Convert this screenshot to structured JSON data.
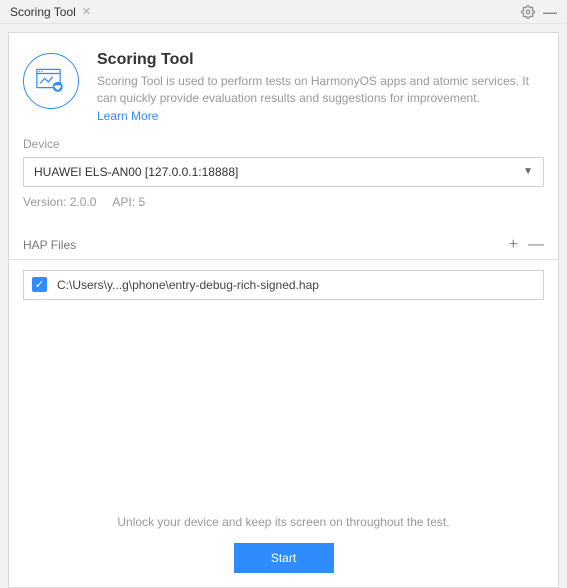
{
  "titlebar": {
    "tab_label": "Scoring Tool"
  },
  "header": {
    "title": "Scoring Tool",
    "desc": "Scoring Tool is used to perform tests on HarmonyOS apps and atomic services. It can quickly provide evaluation results and suggestions for improvement.",
    "learn_more": "Learn More"
  },
  "device": {
    "label": "Device",
    "selected": "HUAWEI ELS-AN00 [127.0.0.1:18888]",
    "version_label": "Version:",
    "version_value": "2.0.0",
    "api_label": "API:",
    "api_value": "5"
  },
  "hap": {
    "title": "HAP Files",
    "items": [
      {
        "checked": true,
        "path": "C:\\Users\\y...g\\phone\\entry-debug-rich-signed.hap"
      }
    ]
  },
  "footer": {
    "hint": "Unlock your device and keep its screen on throughout the test.",
    "start": "Start"
  }
}
